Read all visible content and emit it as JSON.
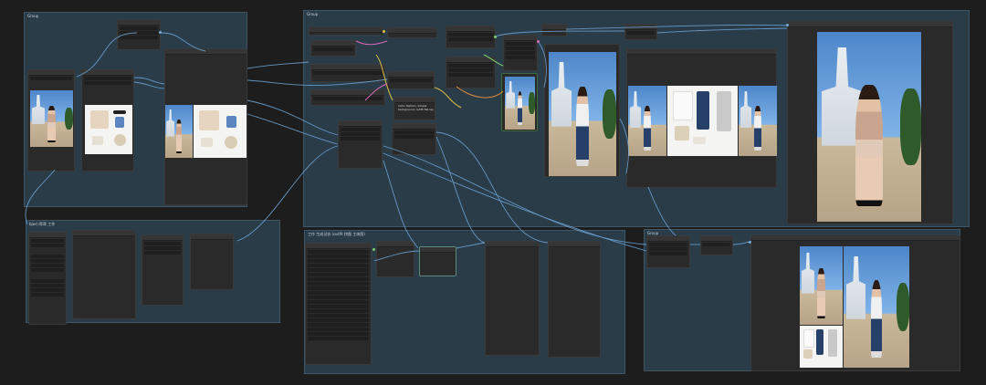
{
  "groups": {
    "g1": "Group",
    "g2": "Group",
    "g3": "bjw小哥哥 工作",
    "g4": "工作 生成试衣 (outfit 拼图 主体图)",
    "g5": "Group"
  },
  "notes": {
    "note_node": "ootd, fashion, simple background, outfit flat lay"
  },
  "colors": {
    "canvas_bg": "#1d1d1d",
    "group_bg": "#2b3c49",
    "node_bg": "#2a2a2a",
    "wire_blue": "#6fa8dc",
    "wire_yellow": "#e0c040",
    "wire_green": "#7ccf6a",
    "wire_pink": "#d86ab8",
    "wire_orange": "#e08a3a"
  },
  "icons": {
    "node_collapse": "dot-icon",
    "preview": "image-icon"
  }
}
